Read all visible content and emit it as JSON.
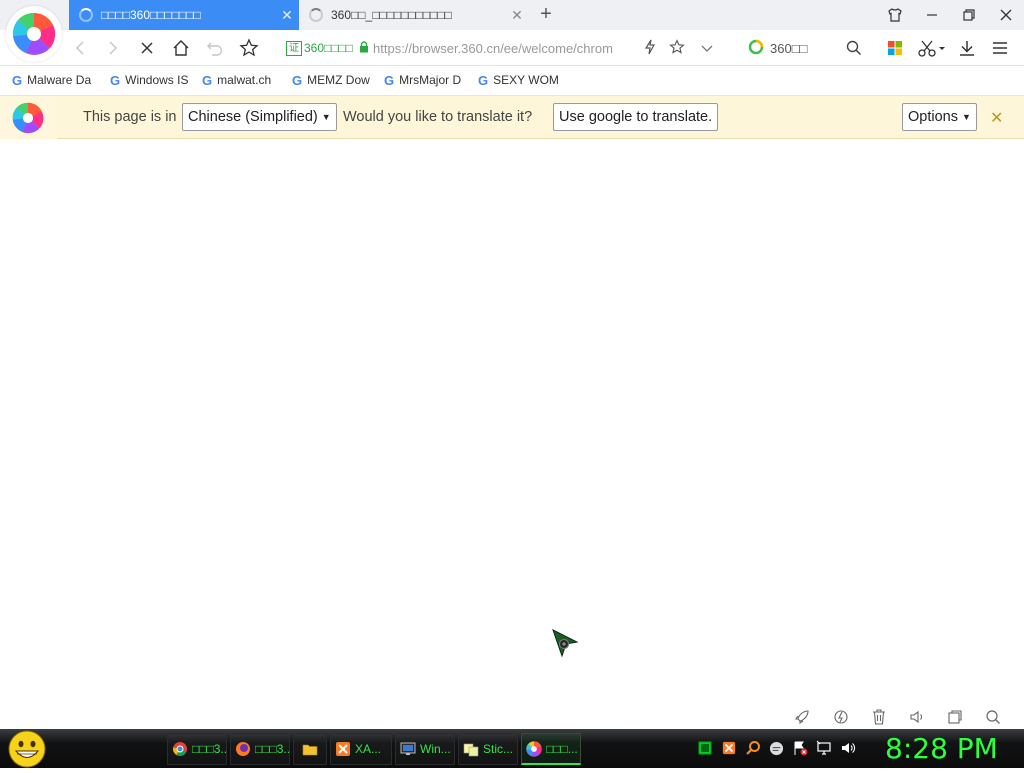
{
  "tabs": [
    {
      "title": "□□□□360□□□□□□□",
      "loading": true,
      "active": true,
      "close": "✕"
    },
    {
      "title": "360□□_□□□□□□□□□□□",
      "loading": true,
      "active": false,
      "close": "✕"
    }
  ],
  "new_tab_label": "+",
  "window_controls": [
    "skin-icon",
    "minimize-icon",
    "restore-icon",
    "close-icon"
  ],
  "nav": {
    "cert_box": "证",
    "cert_label": "360□□□□",
    "url": "https://browser.360.cn/ee/welcome/chrom",
    "search_placeholder": "360□□"
  },
  "bookmarks": [
    {
      "icon": "G",
      "label": "Malware Da"
    },
    {
      "icon": "G",
      "label": "Windows IS"
    },
    {
      "icon": "G",
      "label": "malwat.ch"
    },
    {
      "icon": "G",
      "label": "MEMZ Dow"
    },
    {
      "icon": "G",
      "label": "MrsMajor D"
    },
    {
      "icon": "G",
      "label": "SEXY WOMI"
    }
  ],
  "translate_bar": {
    "prefix": "This page is in",
    "language": "Chinese (Simplified)",
    "question": "Would you like to translate it?",
    "translate_button": "Use google to translate.",
    "options_button": "Options",
    "close": "✕"
  },
  "taskbar": {
    "items": [
      {
        "label": "□□□3...",
        "icon": "chrome-icon"
      },
      {
        "label": "□□□3...",
        "icon": "firefox-icon"
      },
      {
        "label": "",
        "icon": "folder-icon"
      },
      {
        "label": "XA...",
        "icon": "xampp-icon"
      },
      {
        "label": "Win...",
        "icon": "windows-icon"
      },
      {
        "label": "Stic...",
        "icon": "sticky-notes-icon"
      },
      {
        "label": "□□□...",
        "icon": "360-browser-icon"
      }
    ],
    "clock": "8:28 PM"
  },
  "colors": {
    "tab_active": "#3b8cf4",
    "translate_bar": "#fdf6d8",
    "taskbar_text": "#39e24b",
    "clock": "#2cff3c"
  }
}
